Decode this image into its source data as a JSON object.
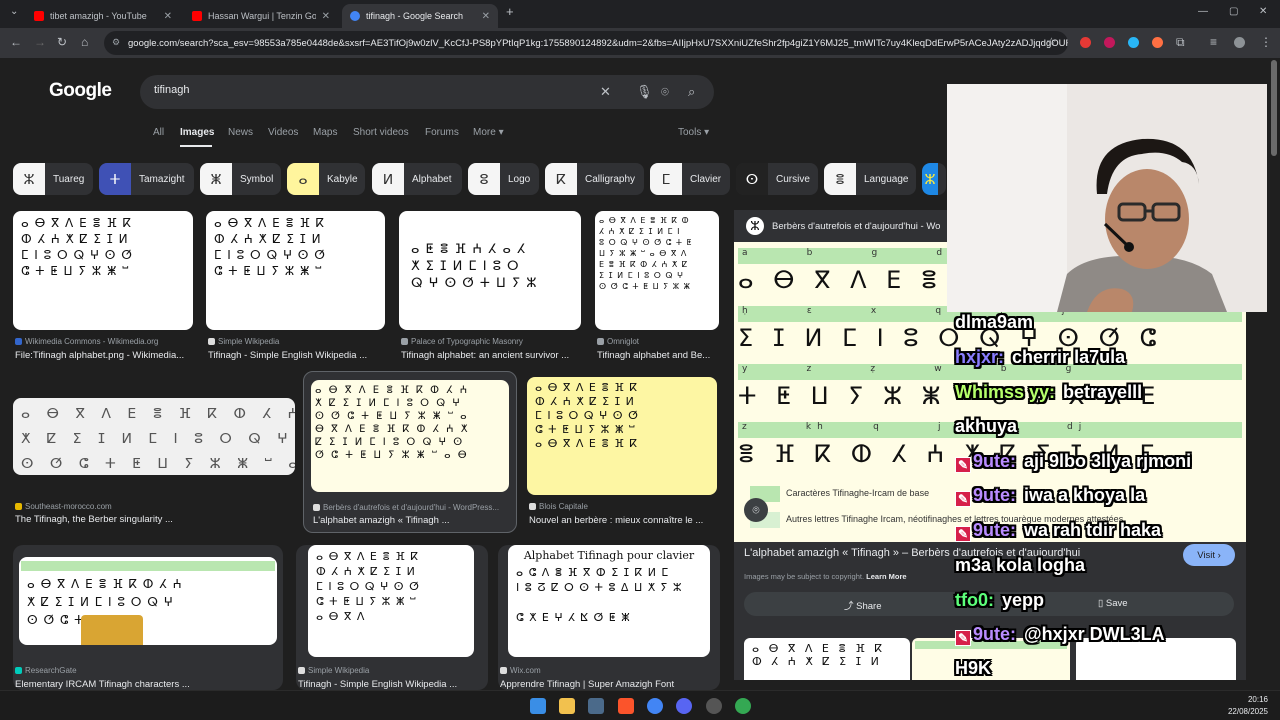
{
  "browser": {
    "tabs": [
      {
        "title": "tibet amazigh - YouTube",
        "color": "#ff0000"
      },
      {
        "title": "Hassan Wargui | Tenzin Gonpo",
        "color": "#ff0000"
      },
      {
        "title": "tifinagh - Google Search",
        "color": "#4285f4"
      }
    ],
    "new_tab": "+",
    "url": "google.com/search?sca_esv=98553a785e0448de&sxsrf=AE3TifOj9w0zlV_KcCfJ-PS8pYPtIqP1kg:1755890124892&udm=2&fbs=AIIjpHxU7SXXniUZfeShr2fp4giZ1Y6MJ25_tmWITc7uy4KleqDdErwP5rACeJAty2zADJjqdgOURr..."
  },
  "google": {
    "logo": "Google",
    "query": "tifinagh",
    "tabs": [
      "All",
      "Images",
      "News",
      "Videos",
      "Maps",
      "Short videos",
      "Forums",
      "More"
    ],
    "tools": "Tools",
    "chips": [
      "Tuareg",
      "Tamazight",
      "Symbol",
      "Kabyle",
      "Alphabet",
      "Logo",
      "Calligraphy",
      "Clavier",
      "Cursive",
      "Language"
    ]
  },
  "results": [
    {
      "source": "Wikimedia Commons - Wikimedia.org",
      "title": "File:Tifinagh alphabet.png - Wikimedia...",
      "fav": "#3366cc"
    },
    {
      "source": "Simple Wikipedia",
      "title": "Tifinagh - Simple English Wikipedia ...",
      "fav": "#dddddd"
    },
    {
      "source": "Palace of Typographic Masonry",
      "title": "Tifinagh alphabet: an ancient survivor ...",
      "fav": "#9aa0a6"
    },
    {
      "source": "Omniglot",
      "title": "Tifinagh alphabet and Be...",
      "fav": "#9aa0a6"
    },
    {
      "source": "Southeast-morocco.com",
      "title": "The Tifinagh, the Berber singularity ...",
      "fav": "#e6b800"
    },
    {
      "source": "Berbèrs d'autrefois et d'aujourd'hui - WordPress...",
      "title": "L'alphabet amazigh « Tifinagh ...",
      "fav": "#dddddd"
    },
    {
      "source": "Blois Capitale",
      "title": "Nouvel an berbère : mieux connaître le ...",
      "fav": "#dddddd"
    },
    {
      "source": "ResearchGate",
      "title": "Elementary IRCAM Tifinagh characters ...",
      "fav": "#00ccbb"
    },
    {
      "source": "Simple Wikipedia",
      "title": "Tifinagh - Simple English Wikipedia ...",
      "fav": "#dddddd"
    },
    {
      "source": "Wix.com",
      "title": "Apprendre Tifinagh | Super Amazigh Font",
      "fav": "#dddddd"
    }
  ],
  "clavier_title": "Alphabet Tifinagh pour clavier",
  "panel": {
    "site": "Berbèrs d'autrefois et d'aujourd'hui - Wo",
    "legend1": "Caractères Tifinaghe-Ircam de base",
    "legend2": "Autres lettres Tifinaghe Ircam, néotifinaghes et lettres touarègue modernes attestées",
    "title": "L'alphabet amazigh « Tifinagh » – Berbèrs d'autrefois et d'aujourd'hui",
    "visit": "Visit",
    "copyright": "Images may be subject to copyright.",
    "learn_more": "Learn More",
    "share": "Share",
    "save": "Save"
  },
  "chat": [
    {
      "user": "",
      "msg": "dlma9am",
      "color": "#ffffff",
      "badge": false
    },
    {
      "user": "hxjxr:",
      "msg": "cherrir la7ula",
      "color": "#8a7dff",
      "badge": false
    },
    {
      "user": "Whimss yy:",
      "msg": "betrayelll",
      "color": "#b6ff6b",
      "badge": false
    },
    {
      "user": "",
      "msg": "akhuya",
      "color": "#ffffff",
      "badge": false
    },
    {
      "user": "9ute:",
      "msg": "aji 9lbo 3llya rjmoni",
      "color": "#b98cff",
      "badge": true
    },
    {
      "user": "9ute:",
      "msg": "iwa a khoya la",
      "color": "#b98cff",
      "badge": true
    },
    {
      "user": "9ute:",
      "msg": "wa rah tdir haka",
      "color": "#b98cff",
      "badge": true
    },
    {
      "user": "",
      "msg": "m3a kola logha",
      "color": "#ffffff",
      "badge": false
    },
    {
      "user": "tfo0:",
      "msg": "yepp",
      "color": "#5cff7a",
      "badge": false
    },
    {
      "user": "9ute:",
      "msg": "@hxjxr DWL3LA",
      "color": "#b98cff",
      "badge": true
    },
    {
      "user": "",
      "msg": "H9K",
      "color": "#ffffff",
      "badge": false
    }
  ],
  "taskbar": {
    "time": "20:16",
    "date": "22/08/2025"
  }
}
